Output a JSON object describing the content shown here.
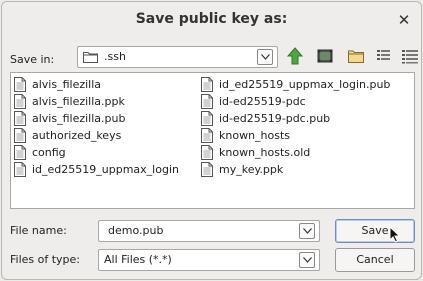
{
  "dialog": {
    "title": "Save public key as:",
    "close_glyph": "✕"
  },
  "save_in": {
    "label": "Save in:",
    "value": ".ssh",
    "icon": "folder-icon"
  },
  "toolbar": {
    "icons": [
      "up-folder-icon",
      "desktop-icon",
      "new-folder-icon",
      "list-view-icon",
      "details-view-icon"
    ]
  },
  "files": {
    "column1": [
      "alvis_filezilla",
      "alvis_filezilla.ppk",
      "alvis_filezilla.pub",
      "authorized_keys",
      "config",
      "id_ed25519_uppmax_login"
    ],
    "column2": [
      "id_ed25519_uppmax_login.pub",
      "id-ed25519-pdc",
      "id-ed25519-pdc.pub",
      "known_hosts",
      "known_hosts.old",
      "my_key.ppk"
    ]
  },
  "file_name": {
    "label": "File name:",
    "value": "demo.pub"
  },
  "file_type": {
    "label": "Files of type:",
    "value": "All Files (*.*)"
  },
  "buttons": {
    "save": "Save",
    "cancel": "Cancel"
  },
  "colors": {
    "up_arrow": "#3a9a3a",
    "folder": "#e8c460",
    "accent": "#6a8fbf"
  }
}
